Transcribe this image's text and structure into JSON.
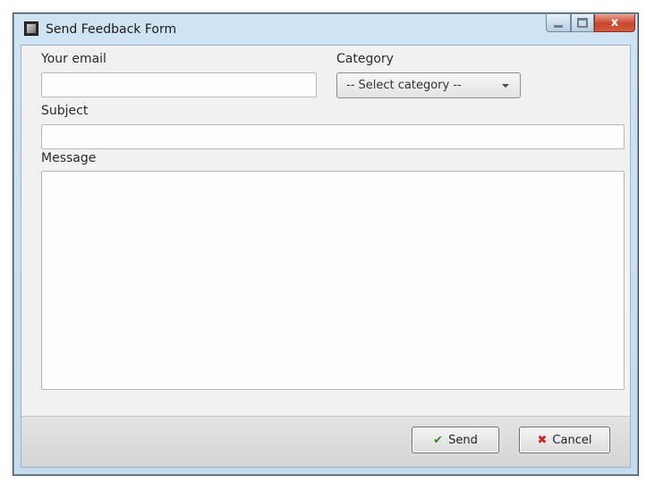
{
  "window": {
    "title": "Send Feedback Form",
    "minimize_icon": "minimize-icon",
    "maximize_icon": "maximize-icon",
    "close_glyph": "x"
  },
  "form": {
    "email_label": "Your email",
    "email_value": "",
    "category_label": "Category",
    "category_selected": "-- Select category --",
    "subject_label": "Subject",
    "subject_value": "",
    "message_label": "Message",
    "message_value": ""
  },
  "buttons": {
    "send_label": "Send",
    "send_icon": "✔",
    "cancel_label": "Cancel",
    "cancel_icon": "✖"
  },
  "colors": {
    "send_icon_color": "#2b8a2b",
    "cancel_icon_color": "#d32222"
  }
}
